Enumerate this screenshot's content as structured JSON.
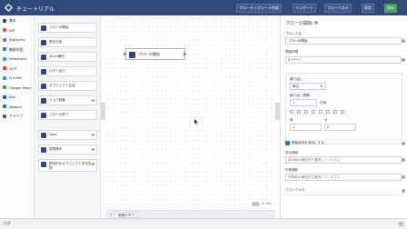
{
  "app": {
    "title": "チュートリアル"
  },
  "toolbar": {
    "flow_template": "フローテンプレート作成",
    "import": "インポート",
    "flow_list": "フローリスト",
    "settings": "設定",
    "save": "保存"
  },
  "sidebar": {
    "items": [
      {
        "label": "基本",
        "color": "#2f4a7a"
      },
      {
        "label": "API",
        "color": "#e64b3c"
      },
      {
        "label": "BigQuery",
        "color": "#4a86e8"
      },
      {
        "label": "機械学習",
        "color": "#3c7ac9"
      },
      {
        "label": "Salesforce",
        "color": "#1fa1e0"
      },
      {
        "label": "GCP",
        "color": "#ea4335"
      },
      {
        "label": "G Suite",
        "color": "#4285f4"
      },
      {
        "label": "Google Maps",
        "color": "#34a853"
      },
      {
        "label": "Box",
        "color": "#0061d5"
      },
      {
        "label": "Watson",
        "color": "#1f70c1"
      },
      {
        "label": "ドライブ",
        "color": "#555555"
      }
    ]
  },
  "palette": {
    "items": [
      {
        "label": "フローの開始",
        "dot": false
      },
      {
        "label": "条件分岐",
        "dot": false
      },
      {
        "label": "Slack通知",
        "dot": false
      },
      {
        "label": "ログへ出力",
        "dot": false
      },
      {
        "label": "オブジェクト生成",
        "dot": false
      },
      {
        "label": "ジョブ起動",
        "dot": true
      },
      {
        "label": "フローの終了",
        "dot": false
      },
      {
        "label": "Data",
        "dot": true
      },
      {
        "label": "変数操作",
        "dot": true
      },
      {
        "label": "配列内のオブジェクト形式変換",
        "dot": true
      }
    ]
  },
  "canvas": {
    "node_label": "フローの開始",
    "tab_label": "無題のタブ",
    "zoom": "0 / 60"
  },
  "panel": {
    "title": "フローの開始",
    "block_name_label": "ブロック名",
    "block_name_value": "フローの開始",
    "schedule_label": "開始時間",
    "schedule_value": "0 * * * *",
    "repeat_label": "繰り返し",
    "repeat_value": "毎日",
    "interval_label": "繰り返し間隔",
    "interval_value": "1",
    "interval_unit": "日毎",
    "hour_label": "時",
    "hour_value": "1",
    "minute_label": "分",
    "minute_value": "0",
    "enable_label": "開始時刻を有効にする",
    "success_label": "成功通知",
    "success_placeholder": "成功時の通知先を選択してください",
    "failure_label": "失敗通知",
    "failure_placeholder": "失敗時の通知先を選択してください",
    "memo_label": "ブロックメモ"
  },
  "bottombar": {
    "label": "ログ"
  }
}
